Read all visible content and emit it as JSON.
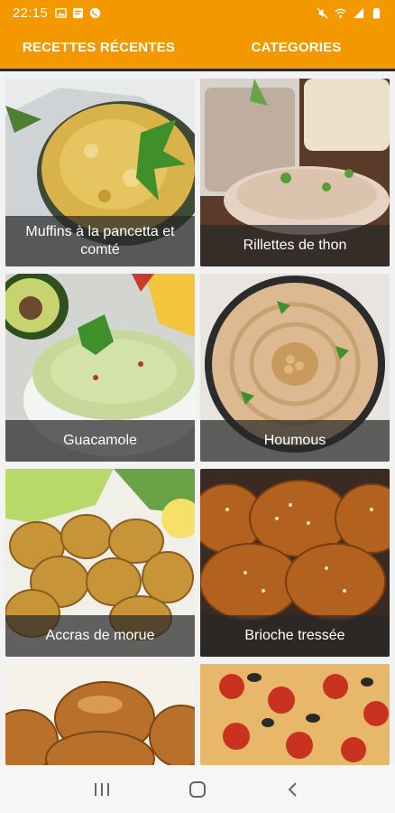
{
  "status_bar": {
    "time": "22:15",
    "left_icons": [
      "gallery-icon",
      "notification-icon",
      "shazam-icon"
    ],
    "right_icons": [
      "mute-icon",
      "wifi-icon",
      "signal-icon",
      "battery-icon"
    ]
  },
  "tabs": [
    {
      "label": "RECETTES RÉCENTES",
      "selected": true
    },
    {
      "label": "CATEGORIES",
      "selected": false
    }
  ],
  "colors": {
    "accent": "#f49800"
  },
  "recipes": [
    {
      "title": "Muffins à la pancetta et comté",
      "image": "muffins-photo"
    },
    {
      "title": "Rillettes de thon",
      "image": "rillettes-photo"
    },
    {
      "title": "Guacamole",
      "image": "guacamole-photo"
    },
    {
      "title": "Houmous",
      "image": "houmous-photo"
    },
    {
      "title": "Accras de morue",
      "image": "accras-photo"
    },
    {
      "title": "Brioche tressée",
      "image": "brioche-photo"
    },
    {
      "title": "",
      "image": "buns-photo"
    },
    {
      "title": "",
      "image": "pizza-photo"
    }
  ],
  "nav_bar": [
    "recents-icon",
    "home-icon",
    "back-icon"
  ]
}
